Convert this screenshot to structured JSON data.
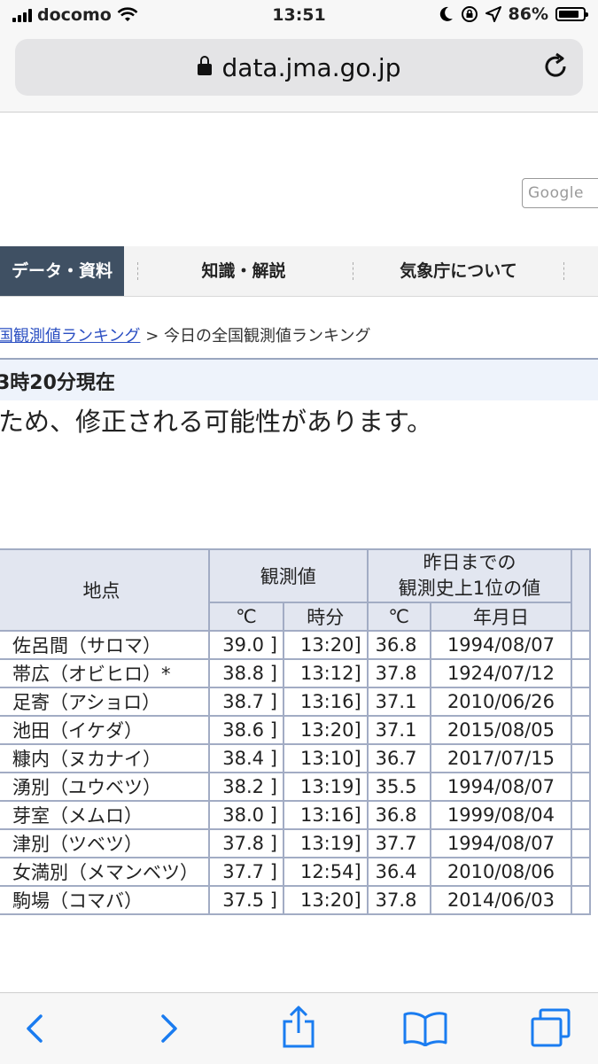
{
  "status": {
    "carrier": "docomo",
    "time": "13:51",
    "battery": "86%",
    "battery_level": 0.86
  },
  "browser": {
    "host": "data.jma.go.jp"
  },
  "header": {
    "search_placeholder": "Google"
  },
  "nav": {
    "items": [
      "データ・資料",
      "知識・解説",
      "気象庁について"
    ]
  },
  "breadcrumb": {
    "link": "国観測値ランキング",
    "separator": ">",
    "current": "今日の全国観測値ランキング"
  },
  "title": {
    "text": "3時20分現在"
  },
  "notice": {
    "text": "ため、修正される可能性があります。"
  },
  "table": {
    "headers": {
      "place": "地点",
      "observed": "観測値",
      "record_line1": "昨日までの",
      "record_line2": "観測史上1位の値",
      "celsius": "℃",
      "time": "時分",
      "record_celsius": "℃",
      "date": "年月日"
    },
    "rows": [
      {
        "place": "佐呂間（サロマ）",
        "value": "39.0 ]",
        "time": "13:20]",
        "record": "36.8",
        "date": "1994/08/07"
      },
      {
        "place": "帯広（オビヒロ）*",
        "value": "38.8 ]",
        "time": "13:12]",
        "record": "37.8",
        "date": "1924/07/12"
      },
      {
        "place": "足寄（アショロ）",
        "value": "38.7 ]",
        "time": "13:16]",
        "record": "37.1",
        "date": "2010/06/26"
      },
      {
        "place": "池田（イケダ）",
        "value": "38.6 ]",
        "time": "13:20]",
        "record": "37.1",
        "date": "2015/08/05"
      },
      {
        "place": "糠内（ヌカナイ）",
        "value": "38.4 ]",
        "time": "13:10]",
        "record": "36.7",
        "date": "2017/07/15"
      },
      {
        "place": "湧別（ユウベツ）",
        "value": "38.2 ]",
        "time": "13:19]",
        "record": "35.5",
        "date": "1994/08/07"
      },
      {
        "place": "芽室（メムロ）",
        "value": "38.0 ]",
        "time": "13:16]",
        "record": "36.8",
        "date": "1999/08/04"
      },
      {
        "place": "津別（ツベツ）",
        "value": "37.8 ]",
        "time": "13:19]",
        "record": "37.7",
        "date": "1994/08/07"
      },
      {
        "place": "女満別（メマンベツ）",
        "value": "37.7 ]",
        "time": "12:54]",
        "record": "36.4",
        "date": "2010/08/06"
      },
      {
        "place": "駒場（コマバ）",
        "value": "37.5 ]",
        "time": "13:20]",
        "record": "37.8",
        "date": "2014/06/03"
      }
    ]
  },
  "colors": {
    "nav_active": "#3f5063",
    "link": "#2b4fc2",
    "ios_blue": "#1a7cf0",
    "table_border": "#a2acc4",
    "table_header": "#e2e6f0"
  }
}
